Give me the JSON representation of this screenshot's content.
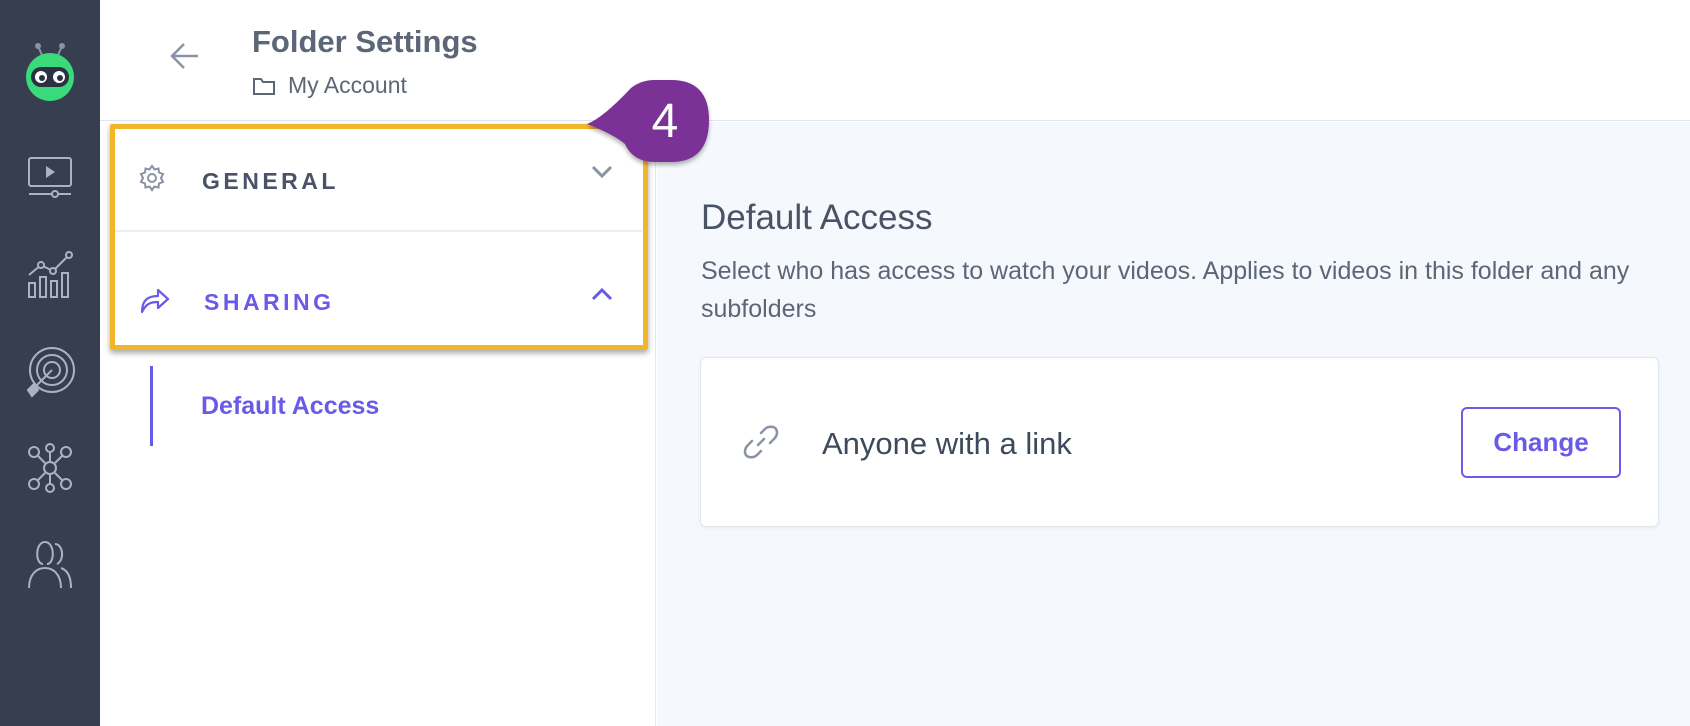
{
  "header": {
    "title": "Folder Settings",
    "breadcrumb": "My Account"
  },
  "nav": {
    "icons": [
      "vidyard-logo-icon",
      "videos-icon",
      "analytics-icon",
      "target-icon",
      "integrations-icon",
      "users-icon"
    ]
  },
  "menu": {
    "sections": [
      {
        "label": "GENERAL",
        "icon": "gear-icon",
        "expanded": false
      },
      {
        "label": "SHARING",
        "icon": "share-icon",
        "expanded": true
      }
    ],
    "sub_items": [
      {
        "label": "Default Access",
        "active": true
      }
    ]
  },
  "annotation": {
    "step": "4"
  },
  "content": {
    "title": "Default Access",
    "description": "Select who has access to watch your videos. Applies to videos in this folder and any subfolders",
    "access": {
      "value": "Anyone with a link",
      "button_label": "Change"
    }
  },
  "colors": {
    "nav_bg": "#363e4f",
    "accent": "#6a5ae8",
    "highlight": "#f1b62c",
    "step_bubble": "#7a3396",
    "content_bg": "#f5f8fd"
  }
}
